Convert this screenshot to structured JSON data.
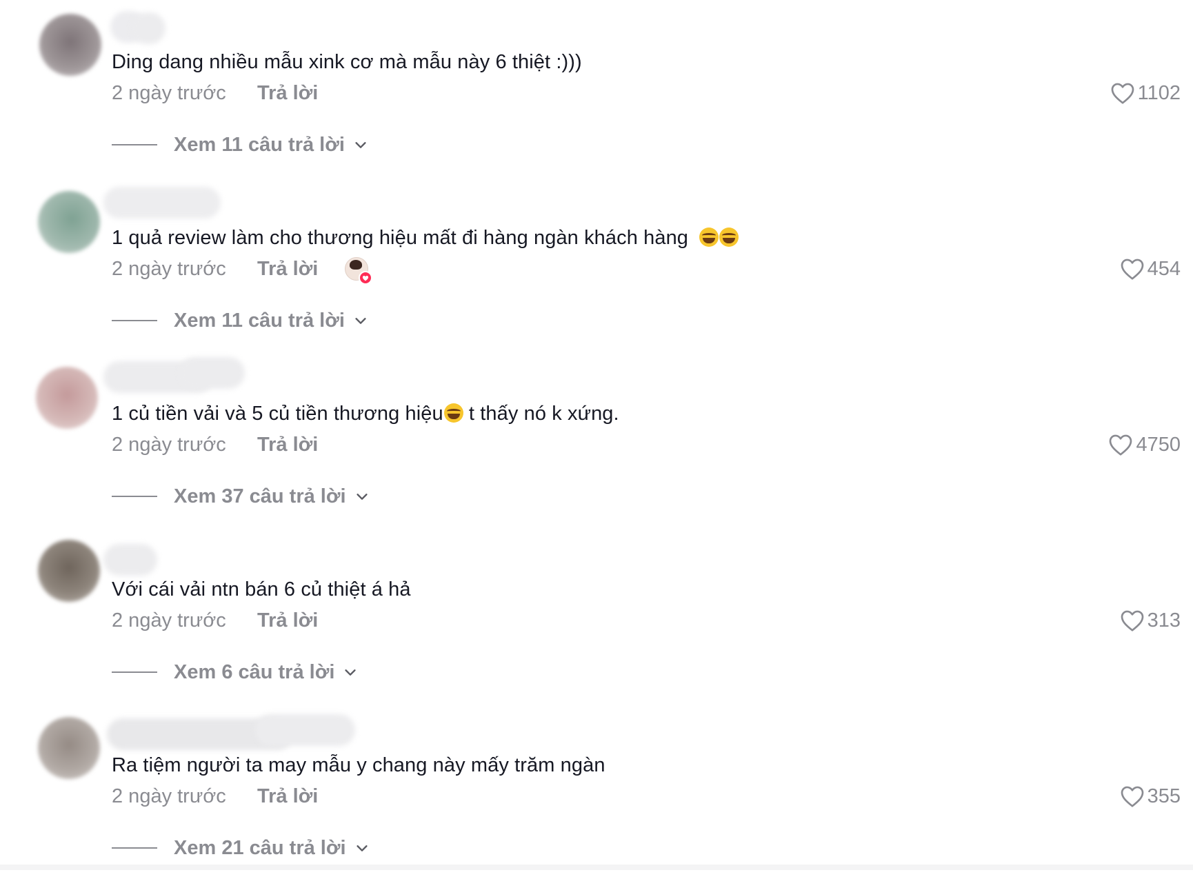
{
  "comments": [
    {
      "text": "Ding dang nhiều mẫu xink cơ mà mẫu này 6 thiệt :)))",
      "time": "2 ngày trước",
      "reply_label": "Trả lời",
      "likes": "1102",
      "view_replies": "Xem 11 câu trả lời",
      "avatar_color": "#8d8589"
    },
    {
      "text": "1 quả review làm cho thương hiệu mất đi hàng ngàn khách hàng",
      "emoji_count": 2,
      "time": "2 ngày trước",
      "reply_label": "Trả lời",
      "likes": "454",
      "view_replies": "Xem 11 câu trả lời",
      "creator_liked": true,
      "avatar_color": "#93ab9f"
    },
    {
      "text_before": "1 củ tiền vải và 5 củ tiền thương hiệu",
      "text_after": " t thấy nó k xứng.",
      "time": "2 ngày trước",
      "reply_label": "Trả lời",
      "likes": "4750",
      "view_replies": "Xem 37 câu trả lời",
      "avatar_color": "#c9a9a8"
    },
    {
      "text": "Với cái vải ntn bán 6 củ thiệt á hả",
      "time": "2 ngày trước",
      "reply_label": "Trả lời",
      "likes": "313",
      "view_replies": "Xem 6 câu trả lời",
      "avatar_color": "#857a70"
    },
    {
      "text": "Ra tiệm người ta may mẫu y chang này mấy trăm ngàn",
      "time": "2 ngày trước",
      "reply_label": "Trả lời",
      "likes": "355",
      "view_replies": "Xem 21 câu trả lời",
      "avatar_color": "#a39a94"
    }
  ],
  "icons": {
    "like": "heart-outline-icon",
    "expand": "chevron-down-icon",
    "emoji": "face-with-tears-of-joy-emoji"
  }
}
